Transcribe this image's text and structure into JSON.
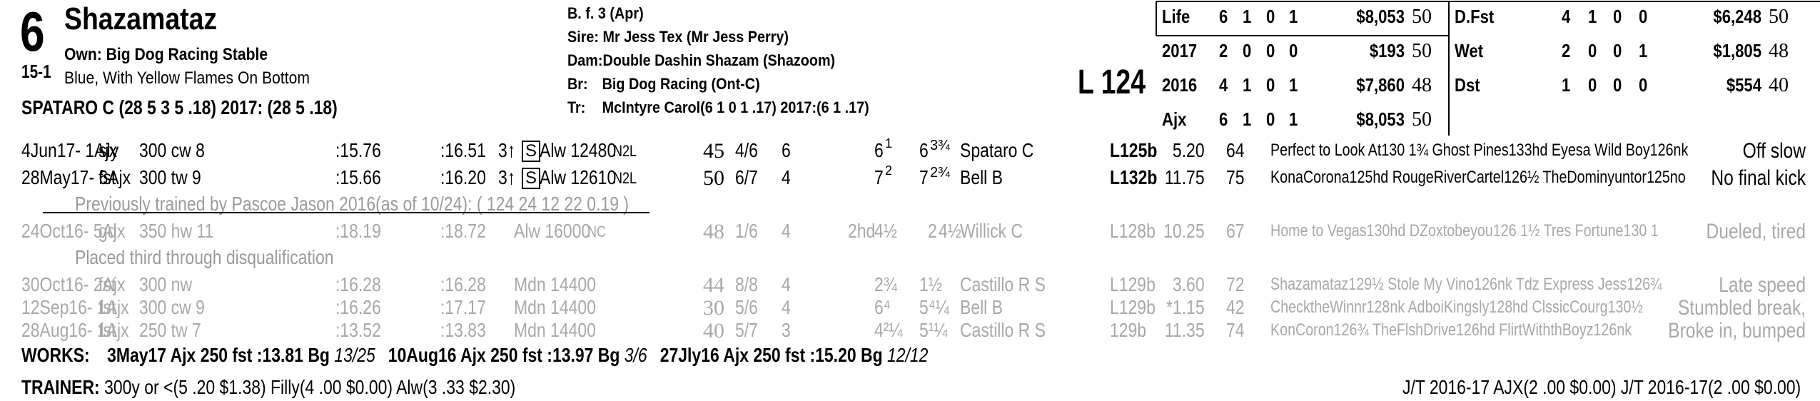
{
  "horse": {
    "post": "6",
    "name": "Shazamataz",
    "odds": "15-1",
    "owner_label": "Own:",
    "owner": "Big Dog Racing Stable",
    "silks": "Blue, With Yellow Flames On Bottom",
    "jockey_line": "SPATARO C (28 5 3 5 .18) 2017: (28 5 .18)",
    "sex_age": "B. f. 3 (Apr)",
    "sire": "Sire: Mr Jess Tex (Mr Jess Perry)",
    "dam_label": "Dam:",
    "dam": "Double Dashin Shazam (Shazoom)",
    "breeder_label": "Br:",
    "breeder": "Big Dog Racing (Ont-C)",
    "trainer_label": "Tr:",
    "trainer": "McIntyre Carol(6 1 0 1 .17)  2017:(6 1 .17)",
    "weight": "L 124"
  },
  "record_left": [
    {
      "label": "Life",
      "st": "6",
      "w": "1",
      "p": "0",
      "s": "1",
      "earn": "$8,053",
      "fig": "50"
    },
    {
      "label": "2017",
      "st": "2",
      "w": "0",
      "p": "0",
      "s": "0",
      "earn": "$193",
      "fig": "50"
    },
    {
      "label": "2016",
      "st": "4",
      "w": "1",
      "p": "0",
      "s": "1",
      "earn": "$7,860",
      "fig": "48"
    },
    {
      "label": "Ajx",
      "st": "6",
      "w": "1",
      "p": "0",
      "s": "1",
      "earn": "$8,053",
      "fig": "50"
    }
  ],
  "record_right": [
    {
      "label": "D.Fst",
      "st": "4",
      "w": "1",
      "p": "0",
      "s": "0",
      "earn": "$6,248",
      "fig": "50"
    },
    {
      "label": "Wet",
      "st": "2",
      "w": "0",
      "p": "0",
      "s": "1",
      "earn": "$1,805",
      "fig": "48"
    },
    {
      "label": "Dst",
      "st": "1",
      "w": "0",
      "p": "0",
      "s": "0",
      "earn": "$554",
      "fig": "40"
    }
  ],
  "races": [
    {
      "date": "4Jun17- 1Ajx",
      "cond": "sly",
      "dist": "300 cw 8",
      "f1": ":15.76",
      "f2": ":16.51",
      "age": "3↑",
      "s": "S",
      "cls": "Alw 12480",
      "sub": "N2L",
      "fig": "45",
      "pp": "4/6",
      "st": "6",
      "c1": "",
      "c2": "6",
      "c2s": "1",
      "fin": "6",
      "fins": "3¾",
      "jock": "Spataro C",
      "wt": "L125b",
      "odds": "5.20",
      "spd": "64",
      "comment": "Perfect to Look At130 1¾ Ghost Pines133hd Eyesa Wild Boy126nk",
      "trip": "Off slow",
      "dim": false
    },
    {
      "date": "28May17- 6Ajx",
      "cond": "fst",
      "dist": "300 tw 9",
      "f1": ":15.66",
      "f2": ":16.20",
      "age": "3↑",
      "s": "S",
      "cls": "Alw 12610",
      "sub": "N2L",
      "fig": "50",
      "pp": "6/7",
      "st": "4",
      "c1": "",
      "c2": "7",
      "c2s": "2",
      "fin": "7",
      "fins": "2¾",
      "jock": "Bell B",
      "wt": "L132b",
      "odds": "11.75",
      "spd": "75",
      "comment": "KonaCorona125hd RougeRiverCartel126½ TheDominyuntor125no",
      "trip": "No final kick",
      "dim": false
    }
  ],
  "note1": "Previously trained by Pascoe Jason 2016(as of 10/24): ( 124 24 12 22 0.19 )",
  "race3": {
    "date": "24Oct16- 5Ajx",
    "cond": "gd",
    "dist": "350 hw 11",
    "f1": ":18.19",
    "f2": ":18.72",
    "cls": "Alw 16000",
    "sub": "NC",
    "fig": "48",
    "pp": "1/6",
    "st": "4",
    "c1": "2hd",
    "c2": "4½",
    "fin": "4½",
    "finpre": "2",
    "jock": "Willick C",
    "wt": "L128b",
    "odds": "10.25",
    "spd": "67",
    "comment": "Home to Vegas130hd DZoxtobeyou126 1½ Tres Fortune130 1",
    "trip": "Dueled, tired"
  },
  "note2": "Placed third through disqualification",
  "races_old": [
    {
      "date": "30Oct16- 2Ajx",
      "cond": "fst",
      "dist": "300 nw",
      "f1": ":16.28",
      "f2": ":16.28",
      "cls": "Mdn 14400",
      "fig": "44",
      "pp": "8/8",
      "st": "4",
      "c2": "2¾",
      "fin": "1½",
      "jock": "Castillo R S",
      "wt": "L129b",
      "odds": "3.60",
      "spd": "72",
      "comment": "Shazamataz129½ Stole My Vino126nk Tdz Express Jess126¾",
      "trip": "Late speed"
    },
    {
      "date": "12Sep16- 1Ajx",
      "cond": "fst",
      "dist": "300 cw 9",
      "f1": ":16.26",
      "f2": ":17.17",
      "cls": "Mdn 14400",
      "fig": "30",
      "pp": "5/6",
      "st": "4",
      "c2": "6⁴",
      "fin": "5⁴¼",
      "jock": "Bell B",
      "wt": "L129b",
      "odds": "*1.15",
      "spd": "42",
      "comment": "ChecktheWinnr128nk AdboiKingsly128hd ClssicCourg130½",
      "trip": "Stumbled break,"
    },
    {
      "date": "28Aug16- 1Ajx",
      "cond": "fst",
      "dist": "250 tw 7",
      "f1": ":13.52",
      "f2": ":13.83",
      "cls": "Mdn 14400",
      "fig": "40",
      "pp": "5/7",
      "st": "3",
      "c2": "4²¼",
      "fin": "5¹¼",
      "jock": "Castillo R S",
      "wt": "129b",
      "odds": "11.35",
      "spd": "74",
      "comment": "KonCoron126¾ TheFlshDrive126hd FlirtWiththBoyz126nk",
      "trip": "Broke in, bumped"
    }
  ],
  "works_label": "WORKS:",
  "works": [
    {
      "date": "3May17",
      "track": "Ajx",
      "dist": "250 fst",
      "time": ":13.81",
      "grade": "Bg",
      "rank": "13/25"
    },
    {
      "date": "10Aug16",
      "track": "Ajx",
      "dist": "250 fst",
      "time": ":13.97",
      "grade": "Bg",
      "rank": "3/6"
    },
    {
      "date": "27Jly16",
      "track": "Ajx",
      "dist": "250 fst",
      "time": ":15.20",
      "grade": "Bg",
      "rank": "12/12"
    }
  ],
  "trainer_label": "TRAINER:",
  "trainer_stats": "300y or <(5 .20 $1.38) Filly(4 .00 $0.00) Alw(3 .33 $2.30)",
  "jt_stats": "J/T 2016-17 AJX(2 .00 $0.00)  J/T 2016-17(2 .00 $0.00)"
}
